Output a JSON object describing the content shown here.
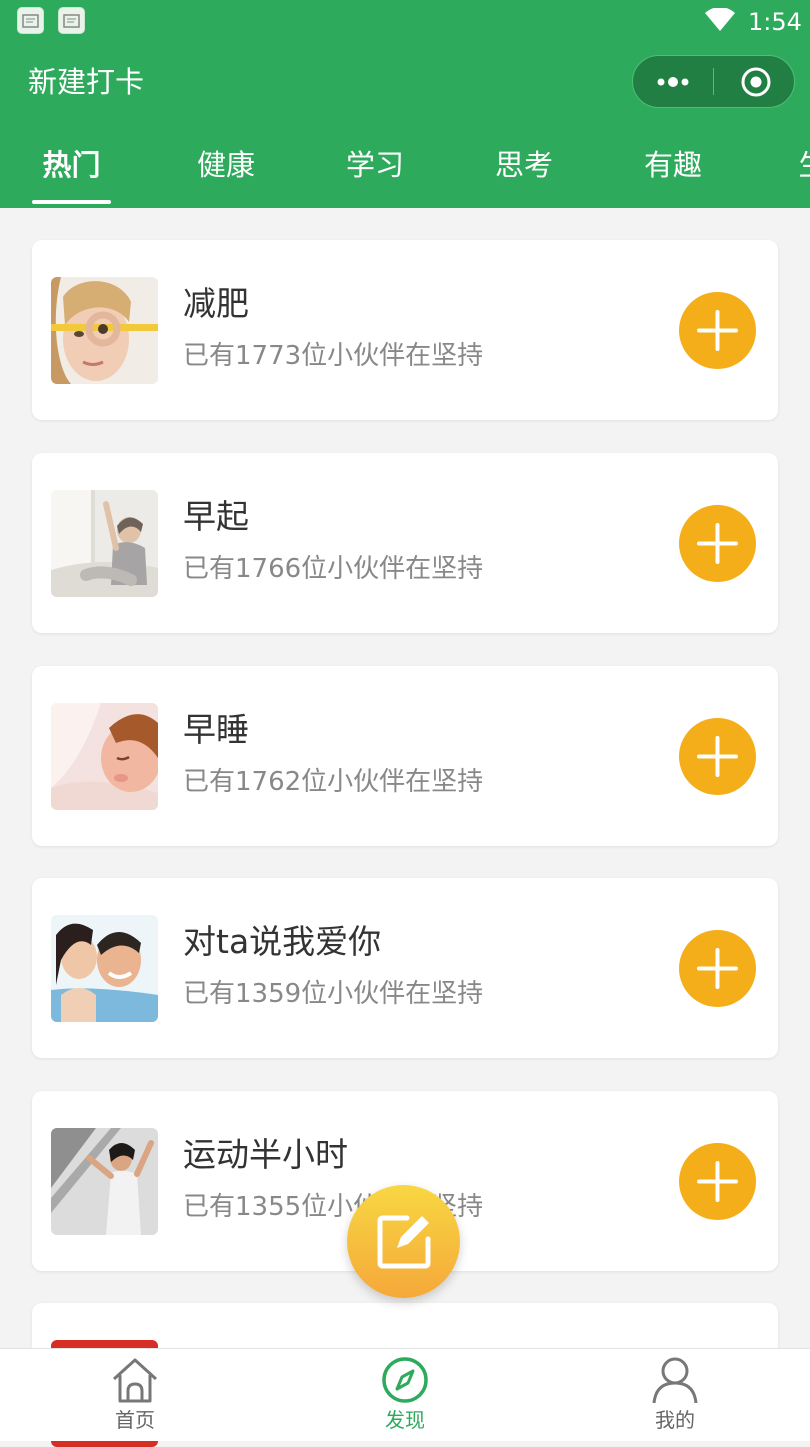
{
  "status_bar": {
    "time": "1:54",
    "notification_icons": [
      "app-notification-icon",
      "app-notification-icon"
    ],
    "wifi_icon": "wifi-icon"
  },
  "nav": {
    "title": "新建打卡",
    "capsule": {
      "more_icon": "more-dots-icon",
      "close_icon": "target-close-icon"
    }
  },
  "tabs": [
    {
      "label": "热门",
      "active": true
    },
    {
      "label": "健康",
      "active": false
    },
    {
      "label": "学习",
      "active": false
    },
    {
      "label": "思考",
      "active": false
    },
    {
      "label": "有趣",
      "active": false
    },
    {
      "label": "生",
      "active": false
    }
  ],
  "habits": [
    {
      "title": "减肥",
      "subtitle": "已有1773位小伙伴在坚持",
      "thumb": "woman-measuring-tape-photo"
    },
    {
      "title": "早起",
      "subtitle": "已有1766位小伙伴在坚持",
      "thumb": "woman-stretching-bed-photo"
    },
    {
      "title": "早睡",
      "subtitle": "已有1762位小伙伴在坚持",
      "thumb": "child-sleeping-photo"
    },
    {
      "title": "对ta说我爱你",
      "subtitle": "已有1359位小伙伴在坚持",
      "thumb": "couple-kiss-photo"
    },
    {
      "title": "运动半小时",
      "subtitle": "已有1355位小伙伴在坚持",
      "thumb": "woman-exercise-photo"
    }
  ],
  "add_icon": "plus-icon",
  "fab_icon": "edit-note-icon",
  "tabbar": [
    {
      "label": "首页",
      "icon": "home-icon",
      "active": false
    },
    {
      "label": "发现",
      "icon": "compass-icon",
      "active": true
    },
    {
      "label": "我的",
      "icon": "user-icon",
      "active": false
    }
  ],
  "colors": {
    "primary_green": "#2eaa5c",
    "accent_orange": "#f4ae1a",
    "page_bg": "#f3f3f3"
  }
}
